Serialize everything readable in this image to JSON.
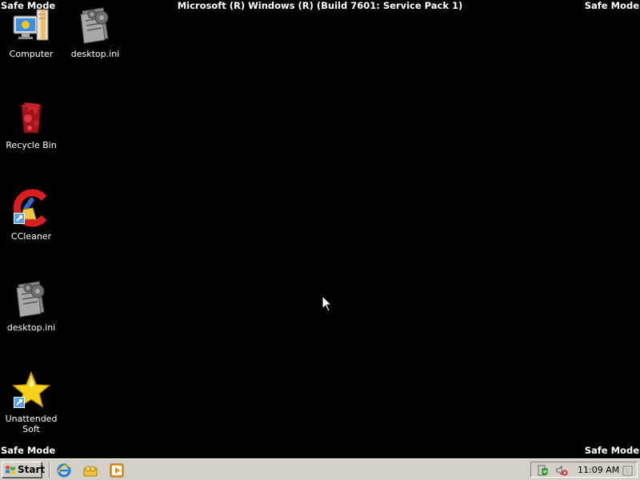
{
  "overlay": {
    "safe_mode": "Safe Mode",
    "title": "Microsoft (R) Windows (R) (Build 7601: Service Pack 1)"
  },
  "desktop": {
    "icons": [
      {
        "label": "Computer",
        "icon": "computer-icon"
      },
      {
        "label": "desktop.ini",
        "icon": "settings-file-icon"
      },
      {
        "label": "Recycle Bin",
        "icon": "recycle-bin-icon"
      },
      {
        "label": "CCleaner",
        "icon": "ccleaner-icon"
      },
      {
        "label": "desktop.ini",
        "icon": "settings-file-icon"
      },
      {
        "label": "Unattended Soft",
        "icon": "star-shortcut-icon"
      }
    ]
  },
  "taskbar": {
    "start_label": "Start",
    "quick_launch": [
      "internet-explorer-icon",
      "folder-users-icon",
      "media-player-icon"
    ],
    "tray": {
      "icons": [
        "action-center-icon",
        "volume-muted-icon",
        "show-desktop-icon"
      ],
      "clock": "11:09 AM"
    }
  },
  "colors": {
    "desktop_bg": "#000000",
    "taskbar_bg": "#d4d0c8",
    "text": "#ffffff"
  }
}
